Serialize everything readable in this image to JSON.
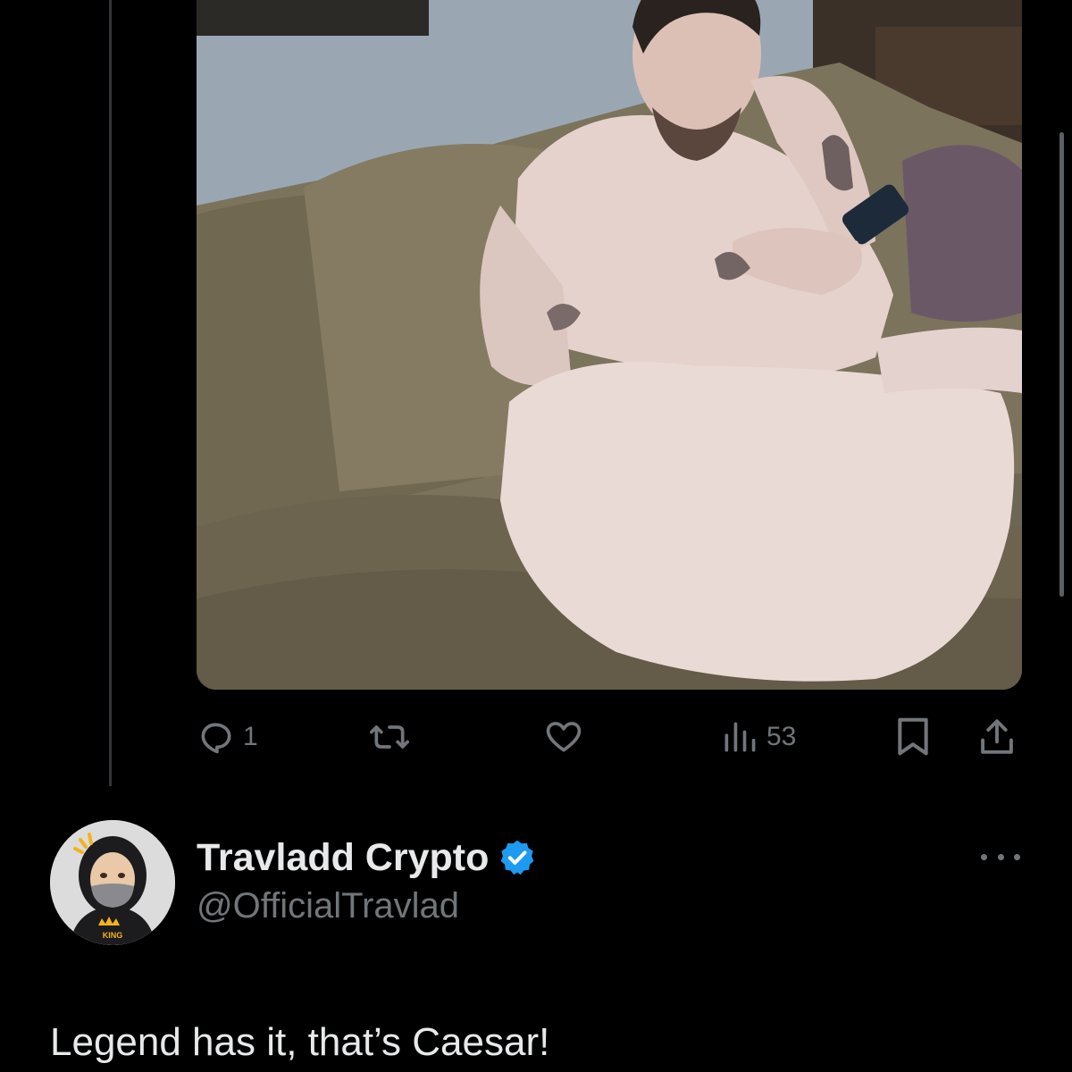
{
  "colors": {
    "background": "#000000",
    "text_primary": "#e7e9ea",
    "text_secondary": "#71767b",
    "verified_blue": "#1d9bf0"
  },
  "media": {
    "icon": "photo"
  },
  "actions": {
    "reply": {
      "icon": "speech-bubble-icon",
      "count": "1"
    },
    "retweet": {
      "icon": "retweet-icon",
      "count": ""
    },
    "like": {
      "icon": "heart-icon",
      "count": ""
    },
    "views": {
      "icon": "bar-chart-icon",
      "count": "53"
    },
    "bookmark": {
      "icon": "bookmark-icon"
    },
    "share": {
      "icon": "share-icon"
    }
  },
  "reply_tweet": {
    "display_name": "Travladd Crypto",
    "handle": "@OfficialTravlad",
    "verified": true,
    "text": "Legend has it, that’s Caesar!",
    "avatar_badge": "KING"
  }
}
